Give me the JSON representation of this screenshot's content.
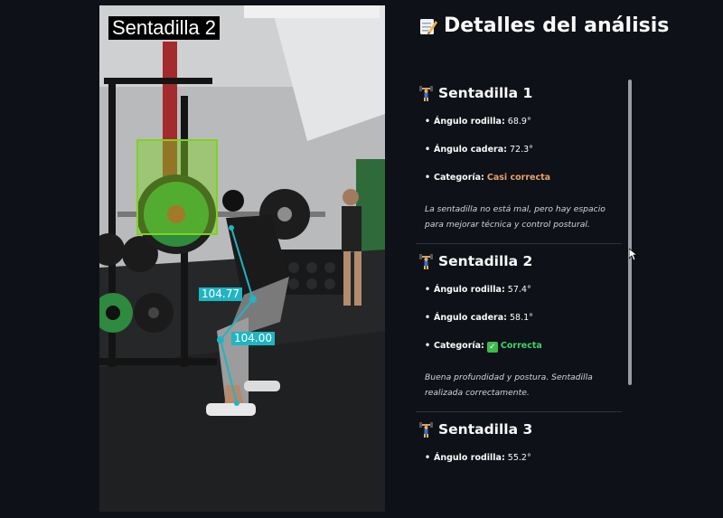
{
  "video": {
    "title": "Sentadilla 2",
    "angle_knee": "104.77",
    "angle_hip": "104.00"
  },
  "panel": {
    "title": "Detalles del análisis",
    "title_icon": "memo-icon",
    "reps": [
      {
        "title": "Sentadilla 1",
        "icon": "weight-lifter-icon",
        "knee_label": "Ángulo rodilla:",
        "knee_value": "68.9°",
        "hip_label": "Ángulo cadera:",
        "hip_value": "72.3°",
        "category_label": "Categoría:",
        "category_value": "Casi correcta",
        "category_color": "#e8a26a",
        "note": "La sentadilla no está mal, pero hay espacio para mejorar técnica y control postural."
      },
      {
        "title": "Sentadilla 2",
        "icon": "weight-lifter-icon",
        "knee_label": "Ángulo rodilla:",
        "knee_value": "57.4°",
        "hip_label": "Ángulo cadera:",
        "hip_value": "58.1°",
        "category_label": "Categoría:",
        "category_value": "Correcta",
        "category_icon": "check-mark-icon",
        "category_color": "#3dd56d",
        "note": "Buena profundidad y postura. Sentadilla realizada correctamente."
      },
      {
        "title": "Sentadilla 3",
        "icon": "weight-lifter-icon",
        "knee_label": "Ángulo rodilla:",
        "knee_value": "55.2°"
      }
    ]
  },
  "colors": {
    "background": "#0e1117",
    "overlay_cyan": "#1fb5c4",
    "detection_box": "#7ed321",
    "warning": "#e8a26a",
    "success": "#3dd56d"
  }
}
